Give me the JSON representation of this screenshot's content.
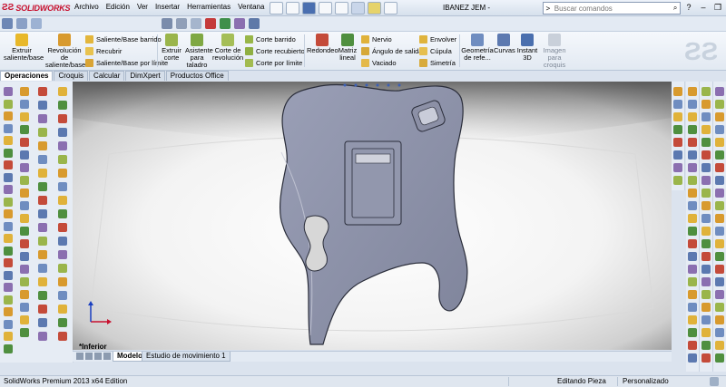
{
  "app": {
    "brand": "SOLIDWORKS",
    "document_title": "IBANEZ JEM -"
  },
  "menu": [
    "Archivo",
    "Edición",
    "Ver",
    "Insertar",
    "Herramientas",
    "Ventana",
    "?"
  ],
  "search": {
    "placeholder": "Buscar comandos"
  },
  "features": {
    "extrude_boss": "Extruir saliente/base",
    "revolve_boss": "Revolución de saliente/base",
    "swept_boss": "Saliente/Base barrido",
    "wrap": "Recubrir",
    "boundary_boss": "Saliente/Base por límite",
    "extrude_cut": "Extruir corte",
    "hole_wizard": "Asistente para taladro",
    "revolve_cut": "Corte de revolución",
    "swept_cut": "Corte barrido",
    "lofted_cut": "Corte recubierto",
    "boundary_cut": "Corte por límite",
    "fillet": "Redondeo",
    "linear_pattern": "Matriz lineal",
    "rib": "Nervio",
    "draft": "Ángulo de salida",
    "shell": "Vaciado",
    "wrap2": "Envolver",
    "dome": "Cúpula",
    "mirror": "Simetría",
    "ref_geometry": "Geometría de refe...",
    "curves": "Curvas",
    "instant3d": "Instant 3D",
    "sketch_picture": "Imagen para croquis"
  },
  "tabs": {
    "operations": "Operaciones",
    "sketch": "Croquis",
    "evaluate": "Calcular",
    "dimxpert": "DimXpert",
    "office": "Productos Office"
  },
  "viewport": {
    "view_label": "*Inferior"
  },
  "bottom_tabs": {
    "model": "Modelo",
    "motion": "Estudio de movimiento 1"
  },
  "status": {
    "edition": "SolidWorks Premium 2013 x64 Edition",
    "mode": "Editando Pieza",
    "custom": "Personalizado"
  },
  "colors": {
    "brand_red": "#c8102e",
    "body_fill": "#8d92a8",
    "ribbon_bg": "#e6ecf4"
  }
}
